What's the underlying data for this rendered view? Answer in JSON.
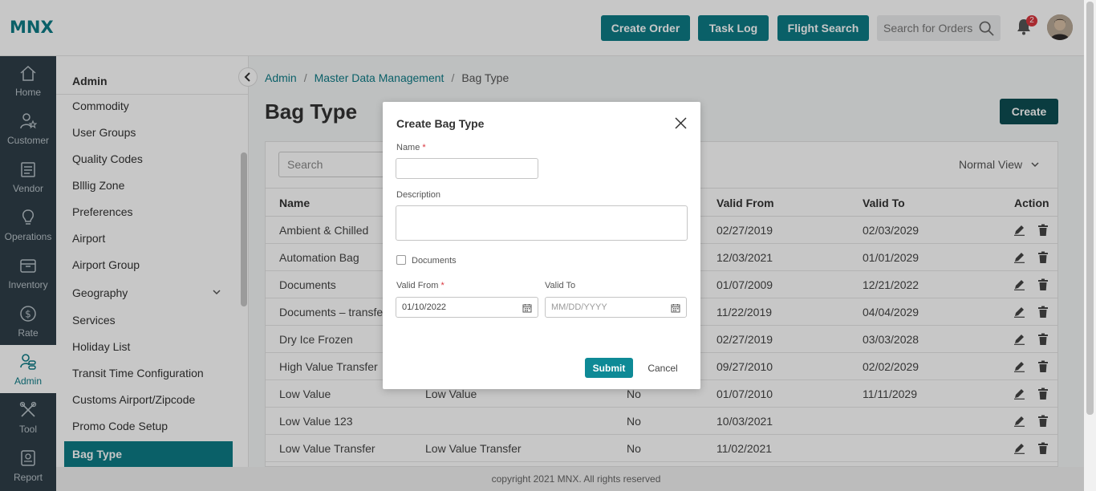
{
  "header": {
    "logo": "MNX",
    "buttons": [
      "Create Order",
      "Task Log",
      "Flight Search"
    ],
    "search_placeholder": "Search for Orders",
    "notification_count": "2"
  },
  "leftnav": [
    {
      "label": "Home",
      "icon": "home-icon"
    },
    {
      "label": "Customer",
      "icon": "customer-icon"
    },
    {
      "label": "Vendor",
      "icon": "vendor-icon"
    },
    {
      "label": "Operations",
      "icon": "operations-icon"
    },
    {
      "label": "Inventory",
      "icon": "inventory-icon"
    },
    {
      "label": "Rate",
      "icon": "rate-icon"
    },
    {
      "label": "Admin",
      "icon": "admin-icon",
      "active": true
    },
    {
      "label": "Tool",
      "icon": "tool-icon"
    },
    {
      "label": "Report",
      "icon": "report-icon"
    }
  ],
  "submenu": {
    "title": "Admin",
    "items": [
      "Commodity",
      "User Groups",
      "Quality Codes",
      "Blllig Zone",
      "Preferences",
      "Airport",
      "Airport Group",
      "Geography",
      "Services",
      "Holiday List",
      "Transit Time Configuration",
      "Customs Airport/Zipcode",
      "Promo Code Setup",
      "Bag Type"
    ],
    "active": "Bag Type"
  },
  "breadcrumb": [
    "Admin",
    "Master Data Management",
    "Bag Type"
  ],
  "page_title": "Bag Type",
  "create_label": "Create",
  "table": {
    "search_placeholder": "Search",
    "view_label": "Normal View",
    "columns": [
      "Name",
      "Valid From",
      "Valid To",
      "Action"
    ],
    "rows": [
      {
        "name": "Ambient & Chilled",
        "desc": "",
        "doc": "",
        "from": "02/27/2019",
        "to": "02/03/2029"
      },
      {
        "name": "Automation Bag",
        "desc": "",
        "doc": "",
        "from": "12/03/2021",
        "to": "01/01/2029"
      },
      {
        "name": "Documents",
        "desc": "",
        "doc": "",
        "from": "01/07/2009",
        "to": "12/21/2022"
      },
      {
        "name": "Documents – transfe",
        "desc": "",
        "doc": "",
        "from": "11/22/2019",
        "to": "04/04/2029"
      },
      {
        "name": "Dry Ice Frozen",
        "desc": "",
        "doc": "",
        "from": "02/27/2019",
        "to": "03/03/2028"
      },
      {
        "name": "High Value Transfer",
        "desc": "",
        "doc": "",
        "from": "09/27/2010",
        "to": "02/02/2029"
      },
      {
        "name": "Low Value",
        "desc": "Low Value",
        "doc": "No",
        "from": "01/07/2010",
        "to": "11/11/2029"
      },
      {
        "name": "Low Value 123",
        "desc": "",
        "doc": "No",
        "from": "10/03/2021",
        "to": ""
      },
      {
        "name": "Low Value Transfer",
        "desc": "Low Value Transfer",
        "doc": "No",
        "from": "11/02/2021",
        "to": ""
      }
    ]
  },
  "footer": "copyright 2021 MNX. All rights reserved",
  "modal": {
    "title": "Create Bag Type",
    "name_label": "Name",
    "description_label": "Description",
    "documents_label": "Documents",
    "valid_from_label": "Valid From",
    "valid_from_value": "01/10/2022",
    "valid_to_label": "Valid To",
    "valid_to_placeholder": "MM/DD/YYYY",
    "submit_label": "Submit",
    "cancel_label": "Cancel"
  },
  "colors": {
    "accent": "#0e7b86",
    "nav_bg": "#2f3e48",
    "dark_button": "#0d4d52"
  }
}
